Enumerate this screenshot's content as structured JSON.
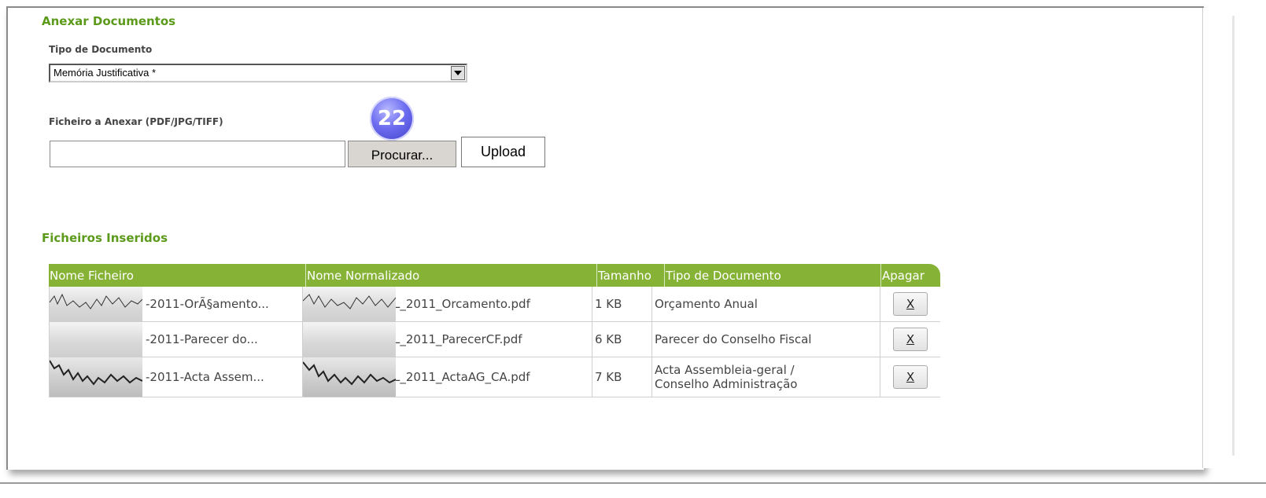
{
  "upload_section": {
    "title": "Anexar Documentos",
    "doc_type_label": "Tipo de Documento",
    "doc_type_value": "Memória Justificativa *",
    "file_label": "Ficheiro a Anexar (PDF/JPG/TIFF)",
    "file_value": "",
    "browse_label": "Procurar...",
    "upload_label": "Upload",
    "step_badge": "22"
  },
  "files_section": {
    "title": "Ficheiros Inseridos",
    "columns": [
      "Nome Ficheiro",
      "Nome Normalizado",
      "Tamanho",
      "Tipo de Documento",
      "Apagar"
    ],
    "rows": [
      {
        "file_name": "-2011-OrÃ§amento...",
        "normalized": "L_2011_Orcamento.pdf",
        "size": "1 KB",
        "doc_type": "Orçamento Anual",
        "delete": "X"
      },
      {
        "file_name": "-2011-Parecer do...",
        "normalized": "L_2011_ParecerCF.pdf",
        "size": "6 KB",
        "doc_type": "Parecer do Conselho Fiscal",
        "delete": "X"
      },
      {
        "file_name": "-2011-Acta Assem...",
        "normalized": "L_2011_ActaAG_CA.pdf",
        "size": "7 KB",
        "doc_type_line1": "Acta Assembleia-geral /",
        "doc_type_line2": "Conselho Administração",
        "delete": "X"
      }
    ]
  },
  "colors": {
    "accent_green": "#5b9a1a",
    "header_green": "#86b336",
    "badge_blue": "#5a5ae0"
  }
}
